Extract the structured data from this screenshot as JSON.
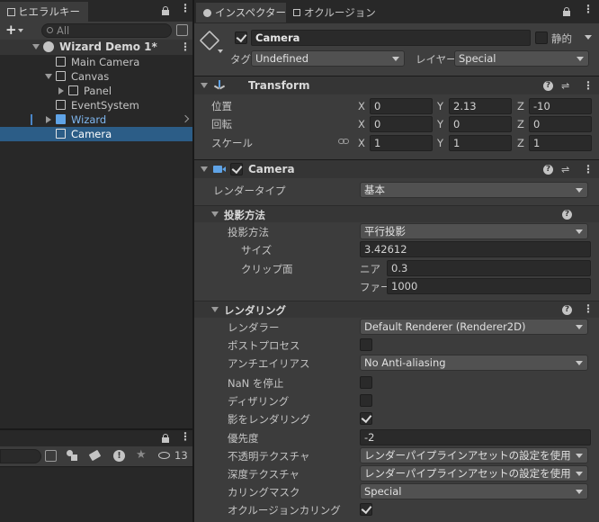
{
  "hierarchy": {
    "tab_label": "ヒエラルキー",
    "add_label": "+",
    "search_placeholder": "All",
    "scene_name": "Wizard Demo 1*",
    "items": [
      {
        "label": "Main Camera"
      },
      {
        "label": "Canvas"
      },
      {
        "label": "Panel"
      },
      {
        "label": "EventSystem"
      },
      {
        "label": "Wizard"
      },
      {
        "label": "Camera"
      }
    ]
  },
  "bottom_panel": {
    "count_label": "13"
  },
  "inspector": {
    "tab_inspector": "インスペクター",
    "tab_occlusion": "オクルージョン",
    "object_name": "Camera",
    "static_label": "静的",
    "tag_label": "タグ",
    "tag_value": "Undefined",
    "layer_label": "レイヤー",
    "layer_value": "Special"
  },
  "transform": {
    "title": "Transform",
    "position_label": "位置",
    "rotation_label": "回転",
    "scale_label": "スケール",
    "axis_x": "X",
    "axis_y": "Y",
    "axis_z": "Z",
    "position": {
      "x": "0",
      "y": "2.13",
      "z": "-10"
    },
    "rotation": {
      "x": "0",
      "y": "0",
      "z": "0"
    },
    "scale": {
      "x": "1",
      "y": "1",
      "z": "1"
    }
  },
  "camera": {
    "title": "Camera",
    "render_type_label": "レンダータイプ",
    "render_type_value": "基本",
    "projection_section": "投影方法",
    "projection_label": "投影方法",
    "projection_value": "平行投影",
    "size_label": "サイズ",
    "size_value": "3.42612",
    "clip_label": "クリップ面",
    "near_label": "ニア",
    "near_value": "0.3",
    "far_label": "ファー",
    "far_value": "1000",
    "rendering_section": "レンダリング",
    "renderer_label": "レンダラー",
    "renderer_value": "Default Renderer (Renderer2D)",
    "post_label": "ポストプロセス",
    "aa_label": "アンチエイリアス",
    "aa_value": "No Anti-aliasing",
    "nan_label": "NaN を停止",
    "dither_label": "ディザリング",
    "shadow_label": "影をレンダリング",
    "priority_label": "優先度",
    "priority_value": "-2",
    "opaque_label": "不透明テクスチャ",
    "opaque_value": "レンダーパイプラインアセットの設定を使用",
    "depth_label": "深度テクスチャ",
    "depth_value": "レンダーパイプラインアセットの設定を使用",
    "culling_label": "カリングマスク",
    "culling_value": "Special",
    "occlusion_label": "オクルージョンカリング"
  }
}
